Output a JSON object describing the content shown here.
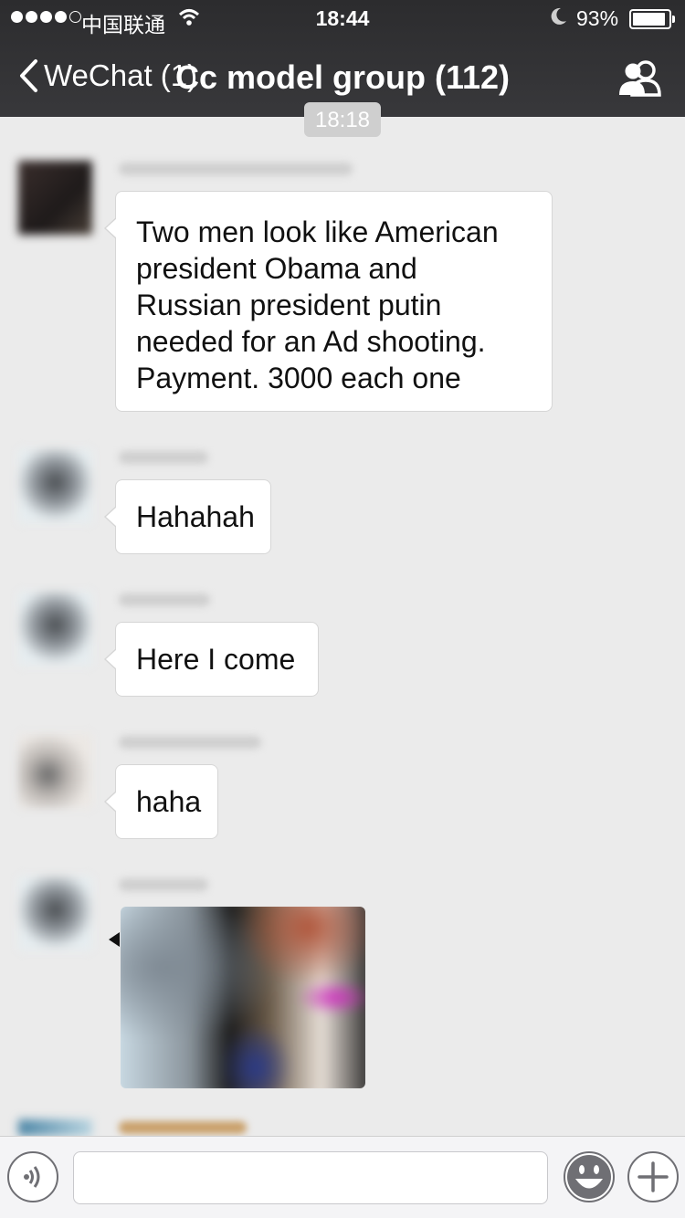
{
  "status_bar": {
    "carrier": "中国联通",
    "time": "18:44",
    "battery_percent": "93%",
    "battery_level": 0.93,
    "signal_bars_filled": 4,
    "signal_bars_total": 5
  },
  "nav": {
    "back_label": "WeChat (1)",
    "title": "Cc model group (112)"
  },
  "time_separator": "18:18",
  "messages": [
    {
      "lines": [
        " Two men look like American",
        "president Obama and",
        "Russian president putin",
        "needed for an Ad shooting.",
        "Payment. 3000 each one"
      ]
    },
    {
      "text": "Hahahah"
    },
    {
      "text": "Here I come"
    },
    {
      "text": "haha"
    }
  ],
  "input": {
    "placeholder": ""
  },
  "icons": {
    "back": "chevron-left-icon",
    "group": "group-members-icon",
    "voice": "voice-icon",
    "emoji": "emoji-icon",
    "add": "plus-icon"
  },
  "colors": {
    "header_bg": "#2c2c2e",
    "chat_bg": "#ebebeb",
    "bubble_bg": "#ffffff"
  }
}
